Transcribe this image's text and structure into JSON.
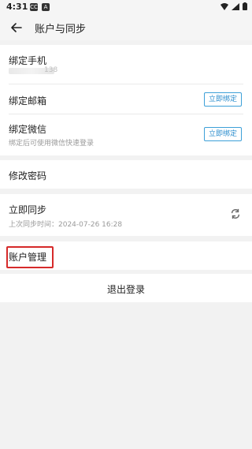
{
  "status_bar": {
    "time": "4:31",
    "badge1": "CC",
    "badge2": "A"
  },
  "app_bar": {
    "title": "账户与同步",
    "back_icon": "arrow-left-icon"
  },
  "phone_section": {
    "label": "绑定手机",
    "value": "138"
  },
  "email_section": {
    "label": "绑定邮箱",
    "button": "立即绑定"
  },
  "wechat_section": {
    "label": "绑定微信",
    "subtitle": "绑定后可使用微信快速登录",
    "button": "立即绑定"
  },
  "password_row": {
    "label": "修改密码"
  },
  "sync_row": {
    "label": "立即同步",
    "subtitle": "上次同步时间：2024-07-26 16:28",
    "icon": "sync-icon"
  },
  "account_manage": {
    "label": "账户管理"
  },
  "logout": {
    "label": "退出登录"
  },
  "colors": {
    "accent": "#2e8fce",
    "highlight": "#d62a2a",
    "background": "#f2f2f2"
  }
}
